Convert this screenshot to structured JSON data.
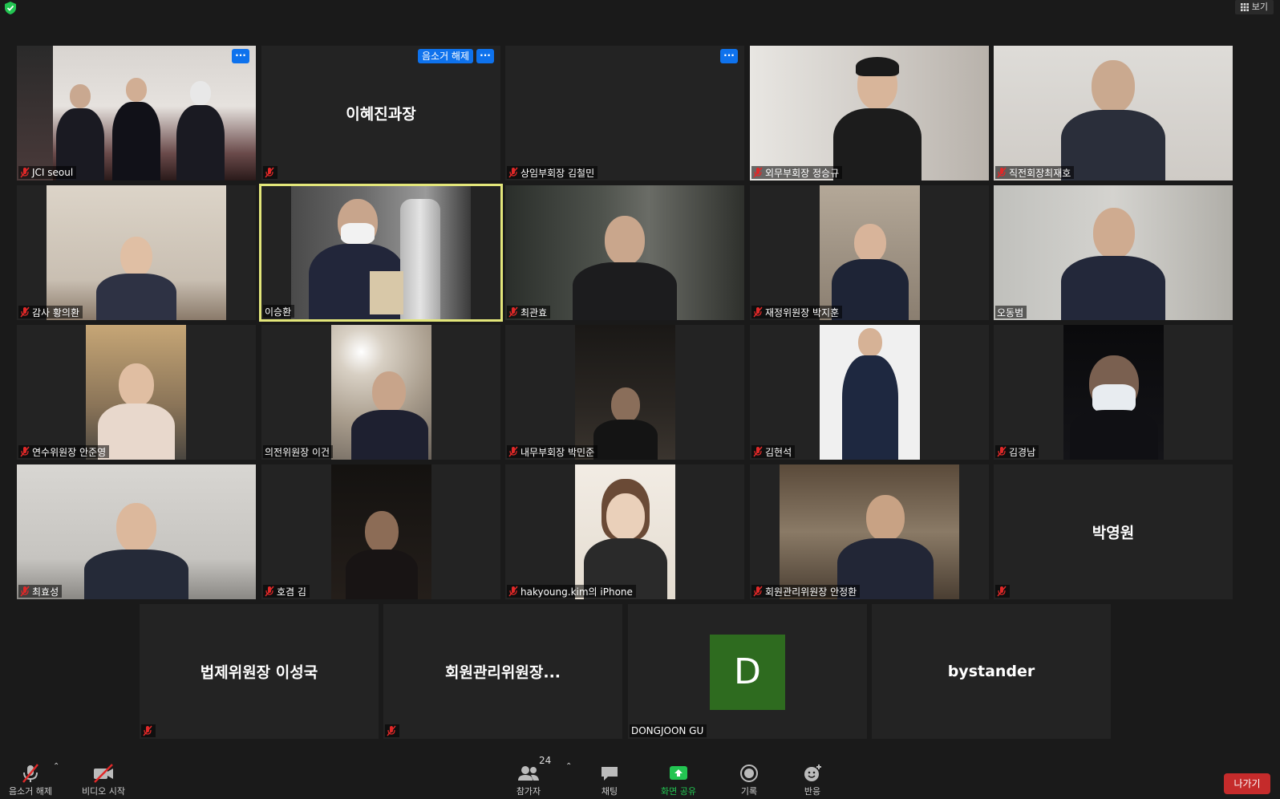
{
  "toolbar_top": {
    "view_label": "보기"
  },
  "tiles": {
    "t1": {
      "name": "JCI seoul"
    },
    "t2": {
      "name": "",
      "center_name": "이혜진과장",
      "unmute_tag": "음소거 해제"
    },
    "t3": {
      "name": "상임부회장 김철민"
    },
    "t4": {
      "name": "외무부회장 정승규"
    },
    "t5": {
      "name": "직전회장최재호"
    },
    "t6": {
      "name": "감사 황의환"
    },
    "t7": {
      "name": "이승환"
    },
    "t8": {
      "name": "최관효"
    },
    "t9": {
      "name": "재정위원장 박지훈"
    },
    "t10": {
      "name": "오동범"
    },
    "t11": {
      "name": "연수위원장 안준영"
    },
    "t12": {
      "name": "의전위원장 이건"
    },
    "t13": {
      "name": "내무부회장 박민준"
    },
    "t14": {
      "name": "김현석"
    },
    "t15": {
      "name": "김경남"
    },
    "t16": {
      "name": "최효성"
    },
    "t17": {
      "name": "호겸 김"
    },
    "t18": {
      "name": "hakyoung.kim의 iPhone"
    },
    "t19": {
      "name": "회원관리위원장 안정환"
    },
    "t20": {
      "name": "",
      "center_name": "박영원"
    },
    "t21": {
      "center_name": "법제위원장 이성국"
    },
    "t22": {
      "center_name": "회원관리위원장..."
    },
    "t23": {
      "name": "DONGJOON GU",
      "avatar_letter": "D"
    },
    "t24": {
      "center_name": "bystander"
    }
  },
  "toolbar": {
    "unmute": "음소거 해제",
    "start_video": "비디오 시작",
    "participants": "참가자",
    "participant_count": "24",
    "chat": "채팅",
    "share_screen": "화면 공유",
    "record": "기록",
    "reactions": "반응",
    "leave": "나가기"
  },
  "colors": {
    "accent": "#0e72ed",
    "active_speaker": "#e3e67a",
    "share_green": "#23c552",
    "leave_red": "#c52b2b",
    "mic_off_red": "#e02828"
  }
}
